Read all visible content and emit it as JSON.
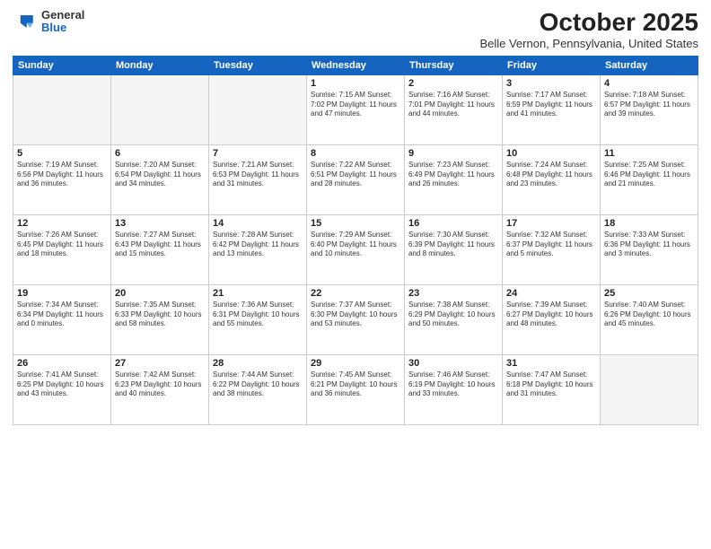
{
  "logo": {
    "general": "General",
    "blue": "Blue"
  },
  "title": "October 2025",
  "location": "Belle Vernon, Pennsylvania, United States",
  "days_of_week": [
    "Sunday",
    "Monday",
    "Tuesday",
    "Wednesday",
    "Thursday",
    "Friday",
    "Saturday"
  ],
  "weeks": [
    [
      {
        "day": "",
        "info": ""
      },
      {
        "day": "",
        "info": ""
      },
      {
        "day": "",
        "info": ""
      },
      {
        "day": "1",
        "info": "Sunrise: 7:15 AM\nSunset: 7:02 PM\nDaylight: 11 hours\nand 47 minutes."
      },
      {
        "day": "2",
        "info": "Sunrise: 7:16 AM\nSunset: 7:01 PM\nDaylight: 11 hours\nand 44 minutes."
      },
      {
        "day": "3",
        "info": "Sunrise: 7:17 AM\nSunset: 6:59 PM\nDaylight: 11 hours\nand 41 minutes."
      },
      {
        "day": "4",
        "info": "Sunrise: 7:18 AM\nSunset: 6:57 PM\nDaylight: 11 hours\nand 39 minutes."
      }
    ],
    [
      {
        "day": "5",
        "info": "Sunrise: 7:19 AM\nSunset: 6:56 PM\nDaylight: 11 hours\nand 36 minutes."
      },
      {
        "day": "6",
        "info": "Sunrise: 7:20 AM\nSunset: 6:54 PM\nDaylight: 11 hours\nand 34 minutes."
      },
      {
        "day": "7",
        "info": "Sunrise: 7:21 AM\nSunset: 6:53 PM\nDaylight: 11 hours\nand 31 minutes."
      },
      {
        "day": "8",
        "info": "Sunrise: 7:22 AM\nSunset: 6:51 PM\nDaylight: 11 hours\nand 28 minutes."
      },
      {
        "day": "9",
        "info": "Sunrise: 7:23 AM\nSunset: 6:49 PM\nDaylight: 11 hours\nand 26 minutes."
      },
      {
        "day": "10",
        "info": "Sunrise: 7:24 AM\nSunset: 6:48 PM\nDaylight: 11 hours\nand 23 minutes."
      },
      {
        "day": "11",
        "info": "Sunrise: 7:25 AM\nSunset: 6:46 PM\nDaylight: 11 hours\nand 21 minutes."
      }
    ],
    [
      {
        "day": "12",
        "info": "Sunrise: 7:26 AM\nSunset: 6:45 PM\nDaylight: 11 hours\nand 18 minutes."
      },
      {
        "day": "13",
        "info": "Sunrise: 7:27 AM\nSunset: 6:43 PM\nDaylight: 11 hours\nand 15 minutes."
      },
      {
        "day": "14",
        "info": "Sunrise: 7:28 AM\nSunset: 6:42 PM\nDaylight: 11 hours\nand 13 minutes."
      },
      {
        "day": "15",
        "info": "Sunrise: 7:29 AM\nSunset: 6:40 PM\nDaylight: 11 hours\nand 10 minutes."
      },
      {
        "day": "16",
        "info": "Sunrise: 7:30 AM\nSunset: 6:39 PM\nDaylight: 11 hours\nand 8 minutes."
      },
      {
        "day": "17",
        "info": "Sunrise: 7:32 AM\nSunset: 6:37 PM\nDaylight: 11 hours\nand 5 minutes."
      },
      {
        "day": "18",
        "info": "Sunrise: 7:33 AM\nSunset: 6:36 PM\nDaylight: 11 hours\nand 3 minutes."
      }
    ],
    [
      {
        "day": "19",
        "info": "Sunrise: 7:34 AM\nSunset: 6:34 PM\nDaylight: 11 hours\nand 0 minutes."
      },
      {
        "day": "20",
        "info": "Sunrise: 7:35 AM\nSunset: 6:33 PM\nDaylight: 10 hours\nand 58 minutes."
      },
      {
        "day": "21",
        "info": "Sunrise: 7:36 AM\nSunset: 6:31 PM\nDaylight: 10 hours\nand 55 minutes."
      },
      {
        "day": "22",
        "info": "Sunrise: 7:37 AM\nSunset: 6:30 PM\nDaylight: 10 hours\nand 53 minutes."
      },
      {
        "day": "23",
        "info": "Sunrise: 7:38 AM\nSunset: 6:29 PM\nDaylight: 10 hours\nand 50 minutes."
      },
      {
        "day": "24",
        "info": "Sunrise: 7:39 AM\nSunset: 6:27 PM\nDaylight: 10 hours\nand 48 minutes."
      },
      {
        "day": "25",
        "info": "Sunrise: 7:40 AM\nSunset: 6:26 PM\nDaylight: 10 hours\nand 45 minutes."
      }
    ],
    [
      {
        "day": "26",
        "info": "Sunrise: 7:41 AM\nSunset: 6:25 PM\nDaylight: 10 hours\nand 43 minutes."
      },
      {
        "day": "27",
        "info": "Sunrise: 7:42 AM\nSunset: 6:23 PM\nDaylight: 10 hours\nand 40 minutes."
      },
      {
        "day": "28",
        "info": "Sunrise: 7:44 AM\nSunset: 6:22 PM\nDaylight: 10 hours\nand 38 minutes."
      },
      {
        "day": "29",
        "info": "Sunrise: 7:45 AM\nSunset: 6:21 PM\nDaylight: 10 hours\nand 36 minutes."
      },
      {
        "day": "30",
        "info": "Sunrise: 7:46 AM\nSunset: 6:19 PM\nDaylight: 10 hours\nand 33 minutes."
      },
      {
        "day": "31",
        "info": "Sunrise: 7:47 AM\nSunset: 6:18 PM\nDaylight: 10 hours\nand 31 minutes."
      },
      {
        "day": "",
        "info": ""
      }
    ]
  ]
}
